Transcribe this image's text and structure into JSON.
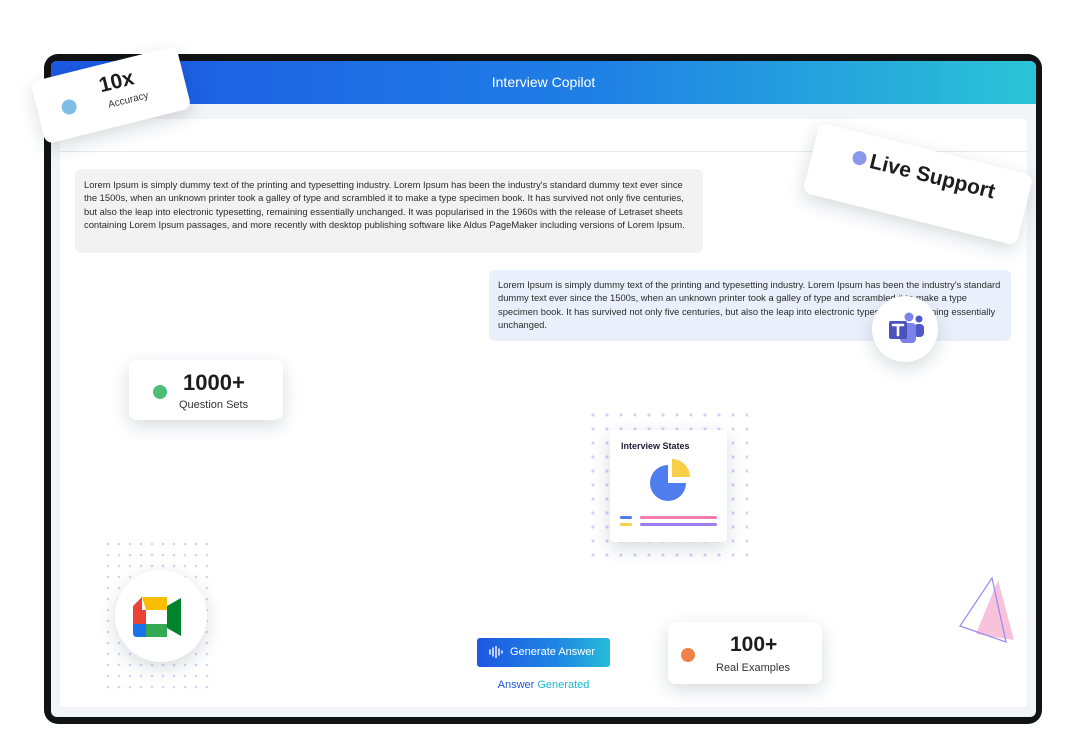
{
  "window": {
    "title": "Interview Copilot"
  },
  "messages": [
    {
      "side": "left",
      "text": "Lorem Ipsum is simply dummy text of the printing and typesetting industry. Lorem Ipsum has been the industry's standard dummy text ever since the 1500s, when an unknown printer took a galley of type and scrambled it to make a type specimen book. It has survived not only five centuries, but also the leap into electronic typesetting, remaining essentially unchanged. It was popularised in the 1960s with the release of Letraset sheets containing Lorem Ipsum passages, and more recently with desktop publishing software like Aldus PageMaker including versions of Lorem Ipsum."
    },
    {
      "side": "right",
      "text": "Lorem Ipsum is simply dummy text of the printing and typesetting industry. Lorem Ipsum has been the industry's standard dummy text ever since the 1500s, when an unknown printer took a galley of type and scrambled it to make a type specimen book. It has survived not only five centuries, but also the leap into electronic typesetting, remaining essentially unchanged."
    }
  ],
  "badges": {
    "accuracy": {
      "value": "10x",
      "label": "Accuracy"
    },
    "live_support": {
      "label": "Live Support"
    },
    "question_sets": {
      "value": "1000+",
      "label": "Question Sets"
    },
    "real_examples": {
      "value": "100+",
      "label": "Real Examples"
    }
  },
  "states_card": {
    "title": "Interview States"
  },
  "actions": {
    "generate_label": "Generate Answer",
    "status_word1": "Answer",
    "status_word2": "Generated"
  },
  "icons": [
    "microsoft-teams-icon",
    "google-meet-icon",
    "waveform-icon",
    "pie-chart-icon"
  ],
  "colors": {
    "header_start": "#1d57e3",
    "header_end": "#2bc4d6",
    "accent_blue": "#1d57e3",
    "accent_cyan": "#20b4d6"
  }
}
